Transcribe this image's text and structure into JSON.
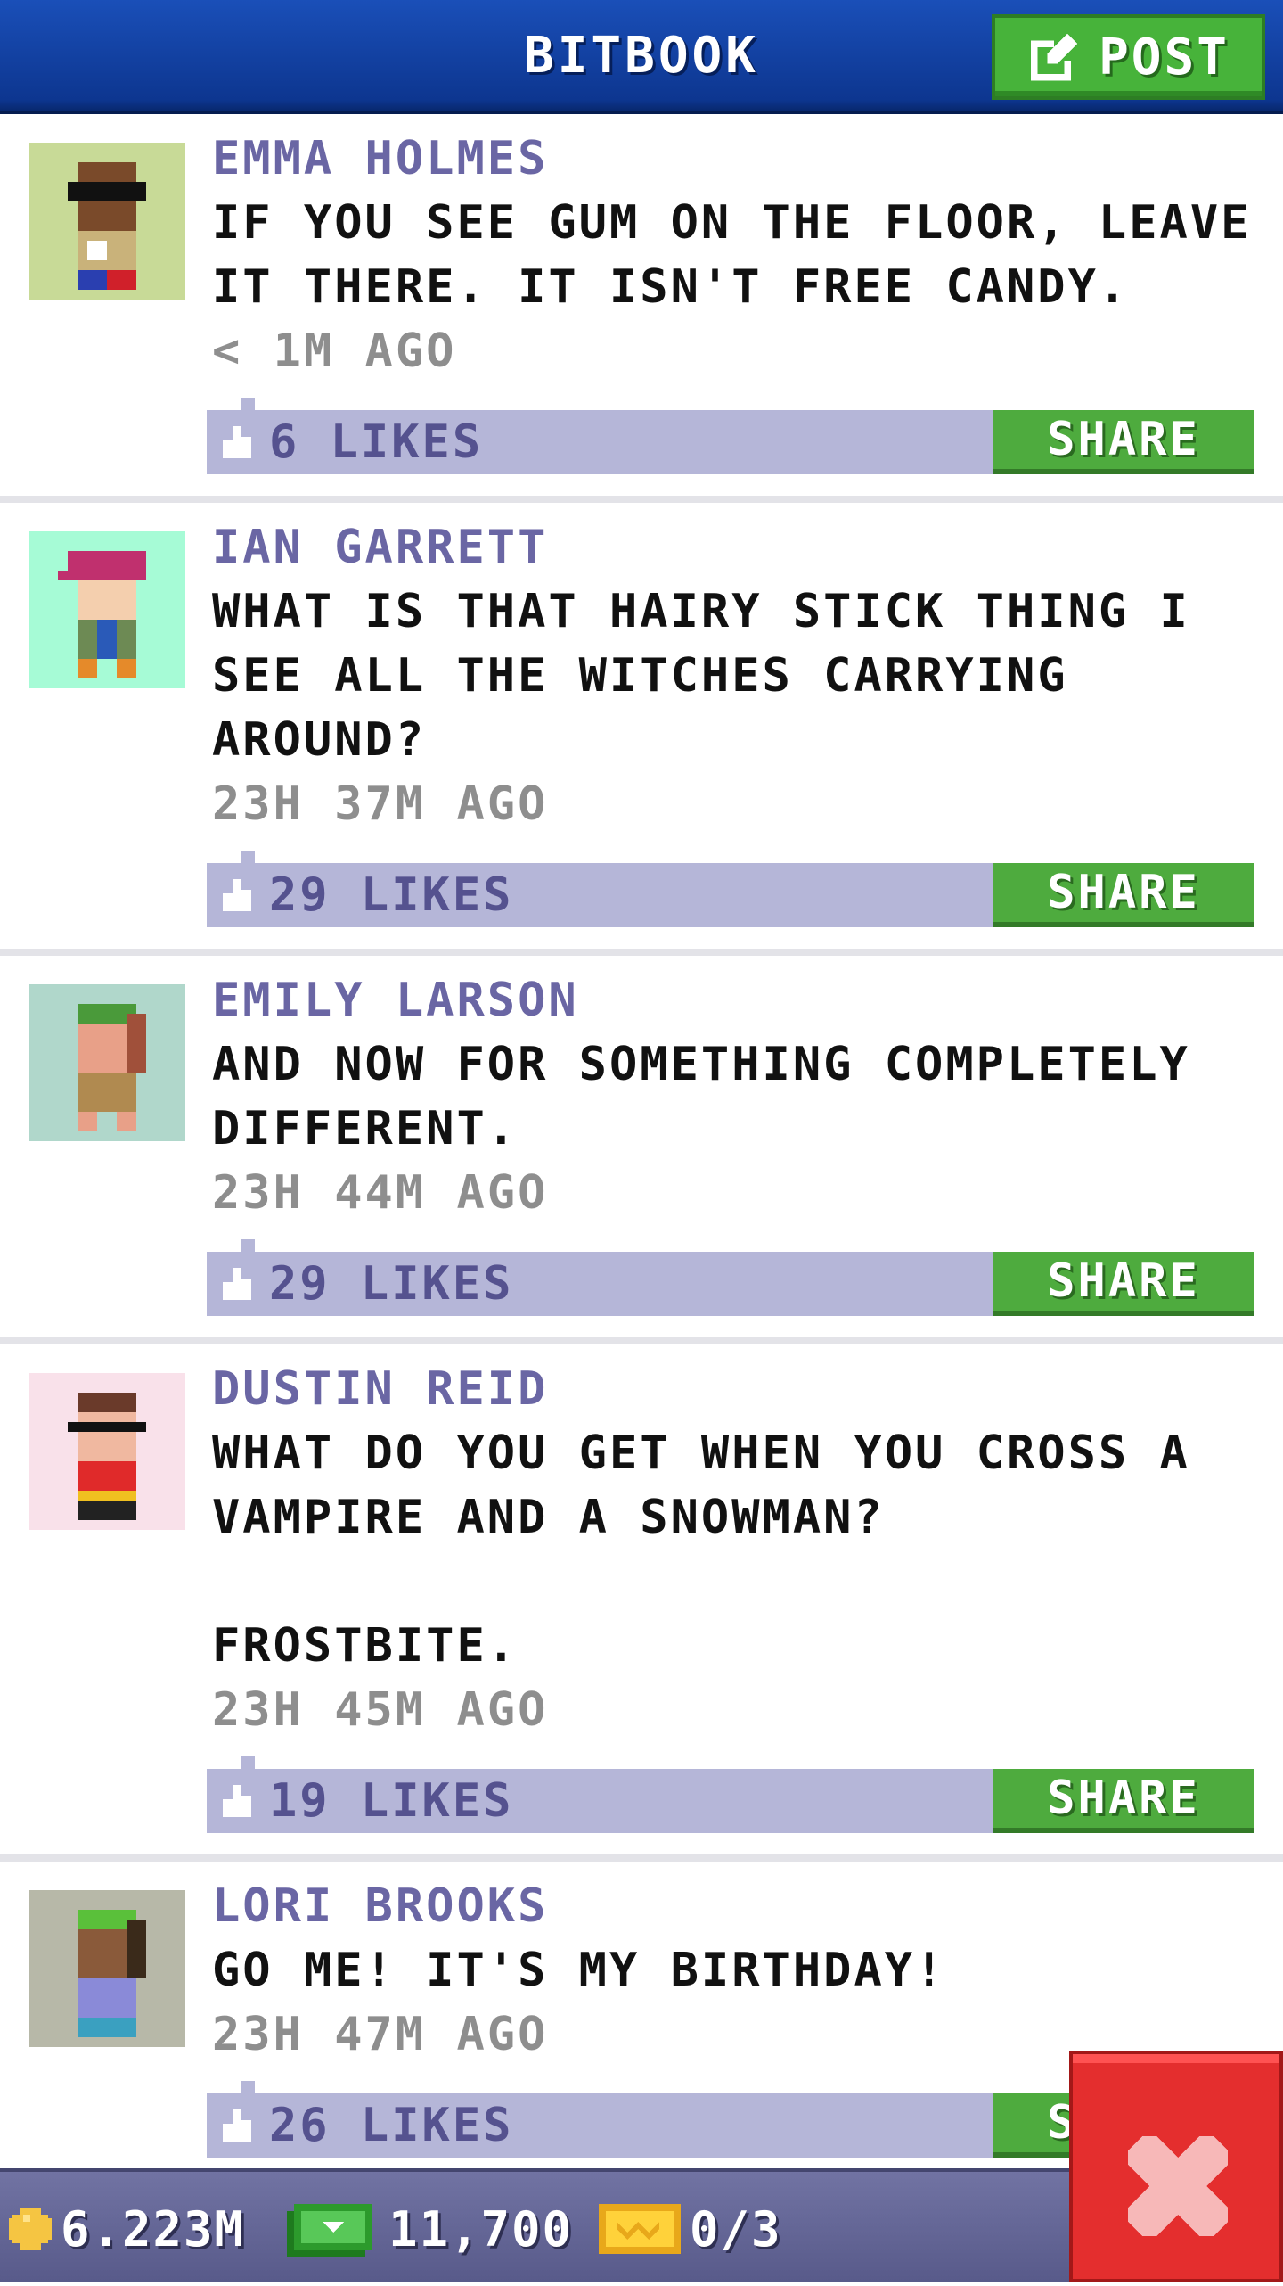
{
  "header": {
    "title": "BITBOOK",
    "post_label": "POST"
  },
  "posts": [
    {
      "author": "EMMA HOLMES",
      "message": "IF YOU SEE GUM ON THE FLOOR, LEAVE IT THERE. IT ISN'T FREE CANDY.",
      "time": "< 1M AGO",
      "likes": "6 LIKES",
      "share": "SHARE",
      "avatar_bg": "#c8da97"
    },
    {
      "author": "IAN GARRETT",
      "message": "WHAT IS THAT HAIRY STICK THING I SEE ALL THE WITCHES CARRYING AROUND?",
      "time": "23H 37M AGO",
      "likes": "29 LIKES",
      "share": "SHARE",
      "avatar_bg": "#a6fbd6"
    },
    {
      "author": "EMILY LARSON",
      "message": "AND NOW FOR SOMETHING COMPLETELY DIFFERENT.",
      "time": "23H 44M AGO",
      "likes": "29 LIKES",
      "share": "SHARE",
      "avatar_bg": "#b0d7cb"
    },
    {
      "author": "DUSTIN REID",
      "message": "WHAT DO YOU GET WHEN YOU CROSS A VAMPIRE AND A SNOWMAN?\n\nFROSTBITE.",
      "time": "23H 45M AGO",
      "likes": "19 LIKES",
      "share": "SHARE",
      "avatar_bg": "#f9e1ea"
    },
    {
      "author": "LORI BROOKS",
      "message": "GO ME! IT'S MY BIRTHDAY!",
      "time": "23H 47M AGO",
      "likes": "26 LIKES",
      "share": "SHARE",
      "avatar_bg": "#b7b8a8"
    }
  ],
  "bottom_bar": {
    "coins": "6.223M",
    "bux": "11,700",
    "tickets": "0/3"
  },
  "colors": {
    "header": "#0d3690",
    "accent_green": "#47b33a",
    "action_bar": "#b5b6d8",
    "close_red": "#e42e2e"
  },
  "icons": {
    "post": "edit-icon",
    "like": "thumbs-up-icon",
    "coin": "coin-icon",
    "bux": "bux-icon",
    "ticket": "ticket-icon",
    "close": "close-icon"
  }
}
